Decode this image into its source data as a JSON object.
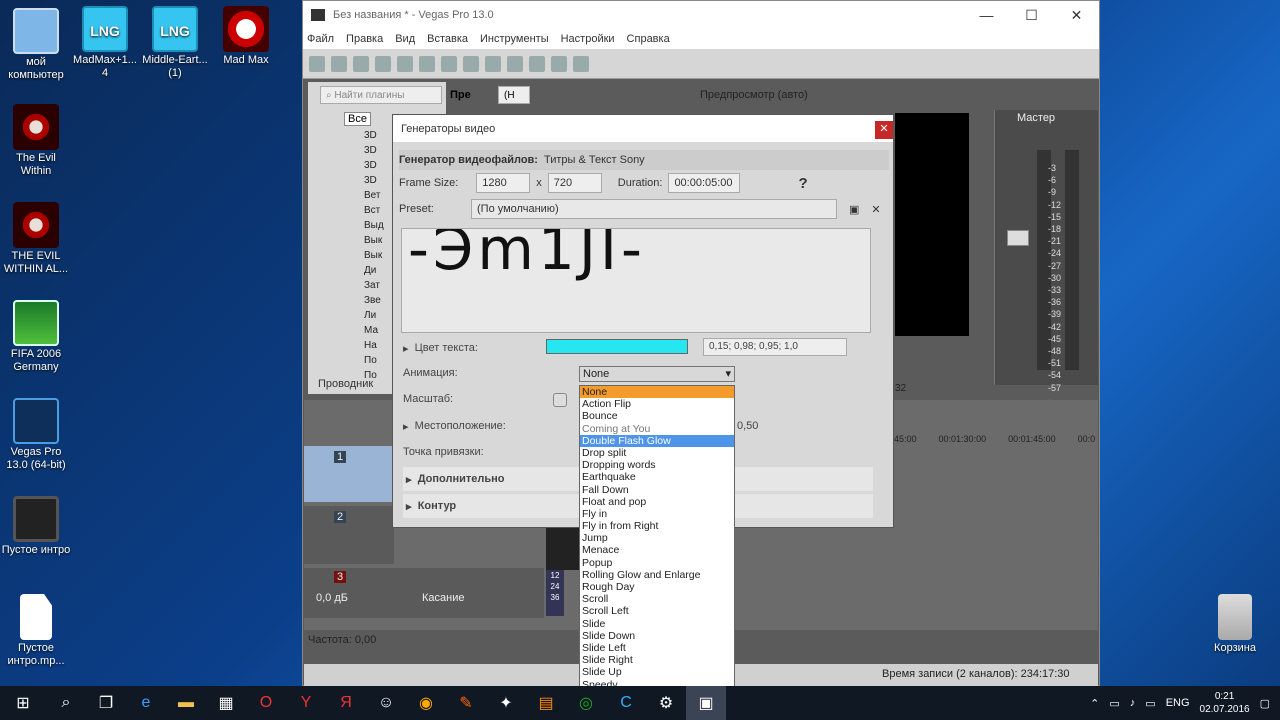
{
  "desktop": [
    {
      "label": "мой компьютер"
    },
    {
      "label": "MadMax+1... 4"
    },
    {
      "label": "Middle-Eart... (1)"
    },
    {
      "label": "Mad Max"
    },
    {
      "label": "The Evil Within"
    },
    {
      "label": "THE EVIL WITHIN AL..."
    },
    {
      "label": "FIFA 2006 Germany"
    },
    {
      "label": "Vegas Pro 13.0 (64-bit)"
    },
    {
      "label": "Пустое интро"
    },
    {
      "label": "Пустое интро.mp..."
    },
    {
      "label": "Корзина"
    }
  ],
  "lng_text": "LNG",
  "window": {
    "title": "Без названия * - Vegas Pro 13.0",
    "min": "—",
    "max": "☐",
    "close": "✕"
  },
  "menu": [
    "Файл",
    "Правка",
    "Вид",
    "Вставка",
    "Инструменты",
    "Настройки",
    "Справка"
  ],
  "toolbar2": {
    "search_placeholder": "Найти плагины",
    "tab": "Пре",
    "zoom": "(Н",
    "preview_label": "Предпросмотр (авто)"
  },
  "tree": {
    "root": "Все",
    "items": [
      "3D",
      "3D",
      "3D",
      "3D",
      "Вет",
      "Вст",
      "Выд",
      "Вык",
      "Вык",
      "Ди",
      "Зат",
      "Зве",
      "Ли",
      "Ма",
      "На",
      "По",
      "По"
    ],
    "footer": "Проводник"
  },
  "dialog": {
    "title": "Генераторы видео",
    "gen_label": "Генератор видеофайлов:",
    "gen_value": "Титры & Текст Sony",
    "frame_label": "Frame Size:",
    "frame_w": "1280",
    "frame_x": "x",
    "frame_h": "720",
    "duration_label": "Duration:",
    "duration": "00:00:05:00",
    "preset_label": "Preset:",
    "preset": "(По умолчанию)",
    "preview_text": "-Эm1JI-",
    "color_label": "Цвет текста:",
    "color_value": "0,15; 0,98; 0,95; 1,0",
    "anim_label": "Анимация:",
    "anim_value": "None",
    "scale_label": "Масштаб:",
    "pos_label": "Местоположение:",
    "pos_value": "0,50",
    "anchor_label": "Точка привязки:",
    "extra_label": "Дополнительно",
    "outline_label": "Контур"
  },
  "anim_options": [
    "None",
    "Action Flip",
    "Bounce",
    "Coming at You",
    "Double Flash Glow",
    "Drop split",
    "Dropping words",
    "Earthquake",
    "Fall Down",
    "Float and pop",
    "Fly in",
    "Fly in from Right",
    "Jump",
    "Menace",
    "Popup",
    "Rolling Glow and Enlarge",
    "Rough Day",
    "Scroll",
    "Scroll Left",
    "Slide",
    "Slide Down",
    "Slide Left",
    "Slide Right",
    "Slide Up",
    "Speedy",
    "Twist In"
  ],
  "master": {
    "label": "Мастер",
    "scale": [
      "-3",
      "-6",
      "-9",
      "-12",
      "-15",
      "-18",
      "-21",
      "-24",
      "-27",
      "-30",
      "-33",
      "-36",
      "-39",
      "-42",
      "-45",
      "-48",
      "-51",
      "-54",
      "-57",
      "-"
    ]
  },
  "timeline": {
    "marks": [
      "45:00",
      "00:01:30:00",
      "00:01:45:00",
      "00:0"
    ],
    "left_time": "32"
  },
  "tracks": {
    "t1": "1",
    "t2": "2",
    "t3": "3",
    "vol": "0,0 дБ",
    "mode": "Касание",
    "rate": "Частота: 0,00",
    "clip_nums": [
      "12",
      "24",
      "36"
    ]
  },
  "status": "Время записи (2 каналов): 234:17:30",
  "taskbar": {
    "lang": "ENG",
    "time": "0:21",
    "date": "02.07.2016"
  }
}
